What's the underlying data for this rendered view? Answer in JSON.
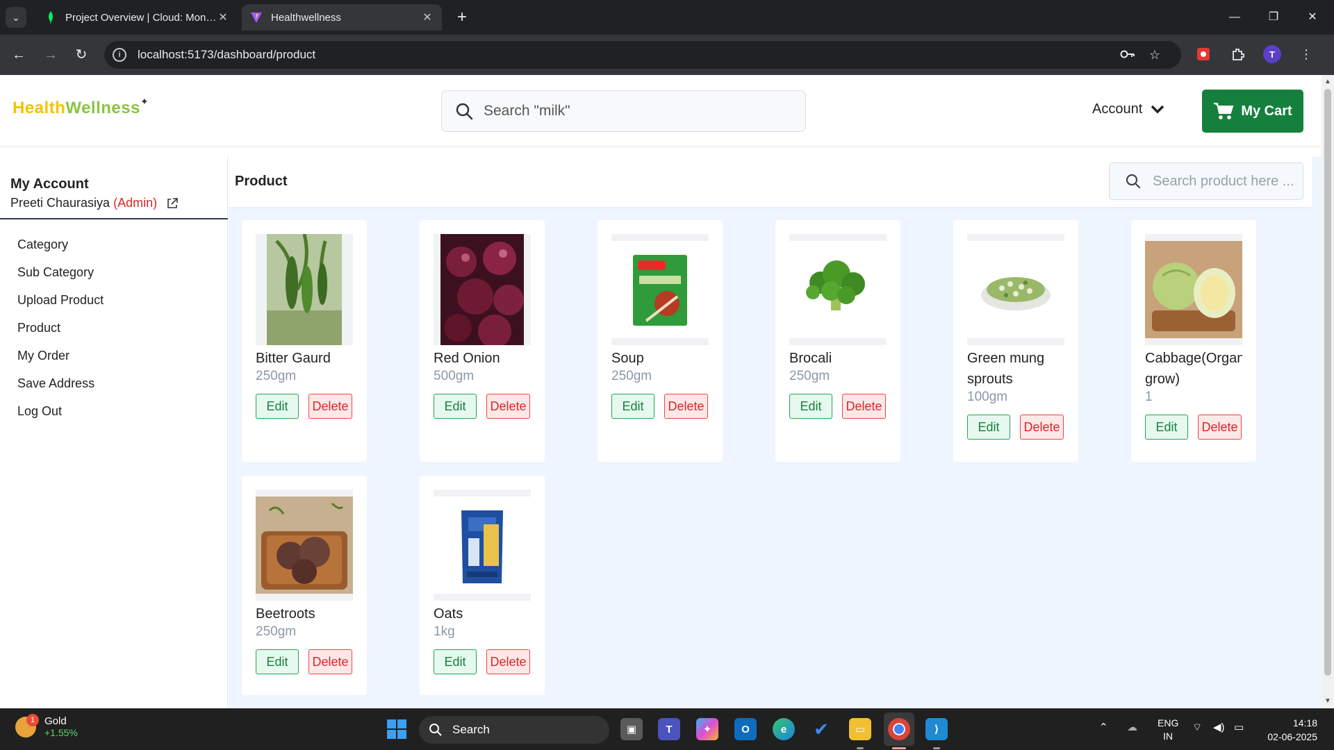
{
  "browser": {
    "tabs": [
      {
        "title": "Project Overview | Cloud: MongoDB Cloud",
        "active": false
      },
      {
        "title": "Healthwellness",
        "active": true
      }
    ],
    "url": "localhost:5173/dashboard/product",
    "profile_initial": "T"
  },
  "header": {
    "logo_part1": "Health",
    "logo_part2": "Wellness",
    "search_placeholder": "Search \"milk\"",
    "account_label": "Account",
    "cart_label": "My Cart"
  },
  "sidebar": {
    "title": "My Account",
    "user_name": "Preeti Chaurasiya",
    "user_role": "(Admin)",
    "items": [
      {
        "label": "Category"
      },
      {
        "label": "Sub Category"
      },
      {
        "label": "Upload Product"
      },
      {
        "label": "Product"
      },
      {
        "label": "My Order"
      },
      {
        "label": "Save Address"
      },
      {
        "label": "Log Out"
      }
    ]
  },
  "main": {
    "title": "Product",
    "search_placeholder": "Search product here ...",
    "edit_label": "Edit",
    "delete_label": "Delete",
    "products": [
      {
        "name": "Bitter Gaurd",
        "unit": "250gm"
      },
      {
        "name": "Red Onion",
        "unit": "500gm"
      },
      {
        "name": "Soup",
        "unit": "250gm"
      },
      {
        "name": "Brocali",
        "unit": "250gm"
      },
      {
        "name": "Green mung sprouts",
        "unit": "100gm"
      },
      {
        "name": "Cabbage(Organically grow)",
        "unit": "1"
      },
      {
        "name": "Beetroots",
        "unit": "250gm"
      },
      {
        "name": "Oats",
        "unit": "1kg"
      }
    ]
  },
  "taskbar": {
    "widget_title": "Gold",
    "widget_value": "+1.55%",
    "widget_badge": "1",
    "search_label": "Search",
    "lang_1": "ENG",
    "lang_2": "IN",
    "time": "14:18",
    "date": "02-06-2025"
  }
}
